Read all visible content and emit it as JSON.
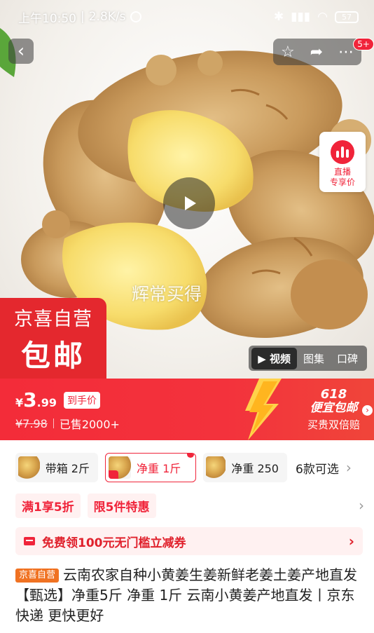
{
  "status_bar": {
    "time": "上午10:50",
    "speed": "2.8K/s",
    "battery": "57"
  },
  "nav": {
    "back_icon": "back-icon",
    "actions": [
      "star-icon",
      "share-icon",
      "more-icon"
    ],
    "notification_count": "5+"
  },
  "hero": {
    "live_label_1": "直播",
    "live_label_2": "专享价",
    "watermark": "辉常买得",
    "badge_line1": "京喜自营",
    "badge_line2": "包邮",
    "media_tabs": [
      "视频",
      "图集",
      "口碑"
    ]
  },
  "price": {
    "currency": "¥",
    "integer": "3",
    "decimal": ".99",
    "hand_price_label": "到手价",
    "original": "¥7.98",
    "sold": "已售2000+",
    "promo_num": "618",
    "promo_text": "便宜包邮",
    "promo_sub": "买贵双倍赔",
    "accent_color": "#f0243a"
  },
  "variants": {
    "items": [
      "带箱 2斤",
      "净重 1斤",
      "净重 250"
    ],
    "selected_index": 1,
    "count_label": "6款可选"
  },
  "promos": {
    "tags": [
      "满1享5折",
      "限5件特惠"
    ]
  },
  "coupon": {
    "text": "免费领100元无门槛立减券"
  },
  "product": {
    "shop_tag": "京喜自营",
    "title": "云南农家自种小黄姜生姜新鲜老姜土姜产地直发【甄选】净重5斤 净重 1斤 云南小黄姜产地直发丨京东快递 更快更好"
  }
}
